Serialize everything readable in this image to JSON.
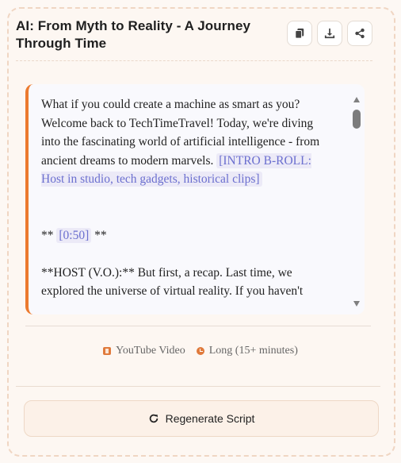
{
  "header": {
    "title": "AI: From Myth to Reality - A Journey Through Time",
    "actions": [
      {
        "icon": "copy-icon"
      },
      {
        "icon": "download-icon"
      },
      {
        "icon": "share-icon"
      }
    ]
  },
  "script": {
    "para1_text": "What if you could create a machine as smart as you? Welcome back to TechTimeTravel! Today, we're diving into the fascinating world of artificial intelligence - from ancient dreams to modern marvels. ",
    "para1_tag": "[INTRO B-ROLL: Host in studio, tech gadgets, historical clips]",
    "para2_prefix": "** ",
    "para2_tag": "[0:50]",
    "para2_suffix": " **",
    "para3_text": "**HOST (V.O.):** But first, a recap. Last time, we explored the universe of virtual reality. If you haven't"
  },
  "meta": {
    "format": "YouTube Video",
    "format_icon": "video-icon",
    "length": "Long (15+ minutes)",
    "length_icon": "clock-icon"
  },
  "regenerate": {
    "label": "Regenerate Script",
    "icon": "refresh-icon"
  },
  "colors": {
    "accent": "#ec7a2e",
    "tag_text": "#6b6fcf",
    "tag_bg": "#eceaf7"
  }
}
